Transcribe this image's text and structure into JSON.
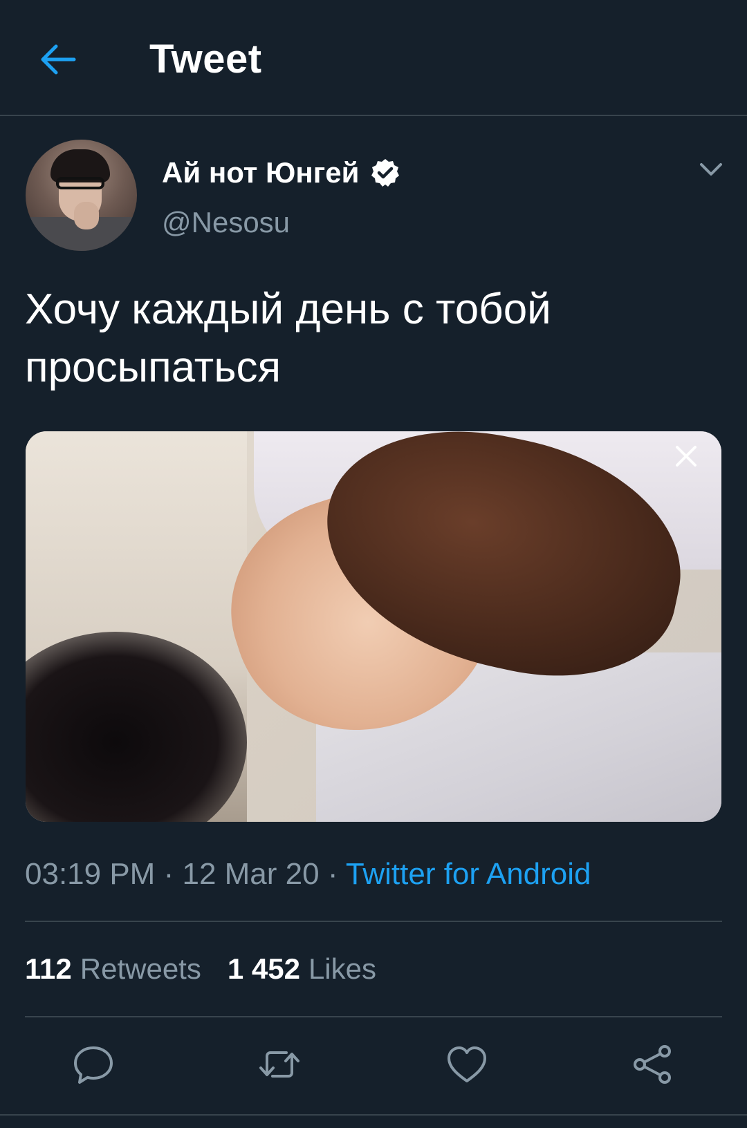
{
  "header": {
    "title": "Tweet",
    "back_icon": "arrow-left-icon"
  },
  "tweet": {
    "author": {
      "display_name": "Ай нот Юнгей",
      "handle": "@Nesosu",
      "verified": true
    },
    "text": "Хочу каждый день с тобой просыпаться",
    "media": {
      "close_icon": "close-icon"
    },
    "meta": {
      "time": "03:19 PM",
      "separator": "·",
      "date": "12 Mar 20",
      "source": "Twitter for Android"
    },
    "stats": {
      "retweets_count": "112",
      "retweets_label": "Retweets",
      "likes_count": "1 452",
      "likes_label": "Likes"
    },
    "actions": [
      "reply-icon",
      "retweet-icon",
      "like-icon",
      "share-icon"
    ]
  },
  "colors": {
    "background": "#15202b",
    "accent": "#1da1f2",
    "secondary_text": "#8899a6",
    "divider": "#38444d"
  }
}
